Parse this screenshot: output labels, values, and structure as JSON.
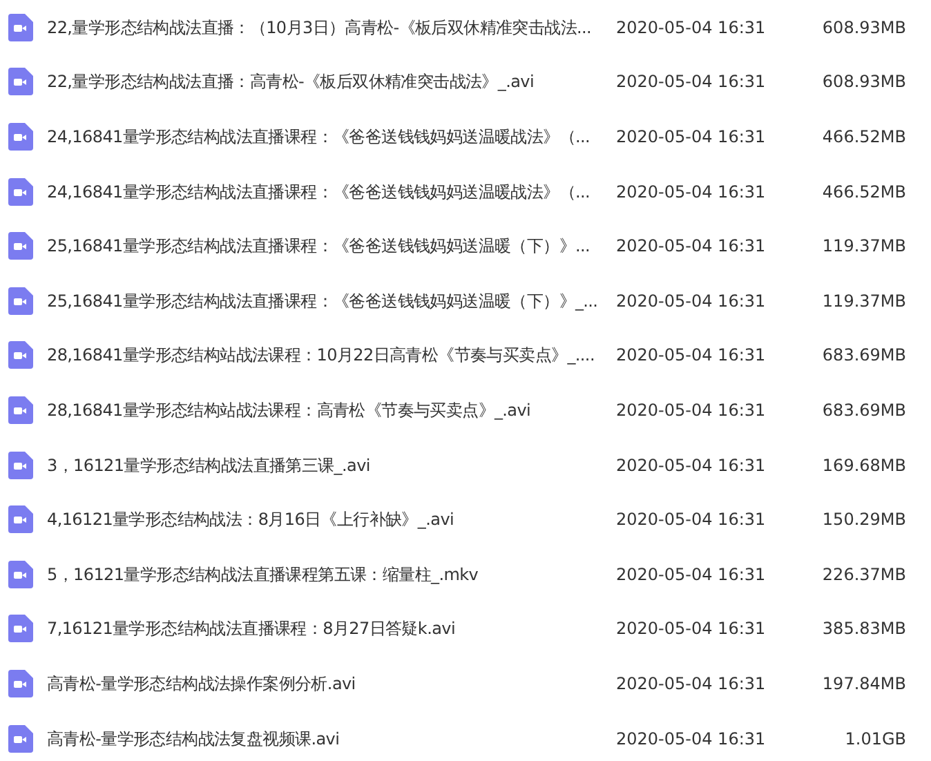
{
  "files": [
    {
      "name": "22,量学形态结构战法直播：（10月3日）高青松-《板后双休精准突击战法...",
      "date": "2020-05-04 16:31",
      "size": "608.93MB"
    },
    {
      "name": "22,量学形态结构战法直播：高青松-《板后双休精准突击战法》_.avi",
      "date": "2020-05-04 16:31",
      "size": "608.93MB"
    },
    {
      "name": "24,16841量学形态结构战法直播课程：《爸爸送钱钱妈妈送温暖战法》（...",
      "date": "2020-05-04 16:31",
      "size": "466.52MB"
    },
    {
      "name": "24,16841量学形态结构战法直播课程：《爸爸送钱钱妈妈送温暖战法》（...",
      "date": "2020-05-04 16:31",
      "size": "466.52MB"
    },
    {
      "name": "25,16841量学形态结构战法直播课程：《爸爸送钱钱妈妈送温暖（下）》...",
      "date": "2020-05-04 16:31",
      "size": "119.37MB"
    },
    {
      "name": "25,16841量学形态结构战法直播课程：《爸爸送钱钱妈妈送温暖（下）》_...",
      "date": "2020-05-04 16:31",
      "size": "119.37MB"
    },
    {
      "name": "28,16841量学形态结构站战法课程：10月22日高青松《节奏与买卖点》_....",
      "date": "2020-05-04 16:31",
      "size": "683.69MB"
    },
    {
      "name": "28,16841量学形态结构站战法课程：高青松《节奏与买卖点》_.avi",
      "date": "2020-05-04 16:31",
      "size": "683.69MB"
    },
    {
      "name": "3，16121量学形态结构战法直播第三课_.avi",
      "date": "2020-05-04 16:31",
      "size": "169.68MB"
    },
    {
      "name": "4,16121量学形态结构战法：8月16日《上行补缺》_.avi",
      "date": "2020-05-04 16:31",
      "size": "150.29MB"
    },
    {
      "name": "5，16121量学形态结构战法直播课程第五课：缩量柱_.mkv",
      "date": "2020-05-04 16:31",
      "size": "226.37MB"
    },
    {
      "name": "7,16121量学形态结构战法直播课程：8月27日答疑k.avi",
      "date": "2020-05-04 16:31",
      "size": "385.83MB"
    },
    {
      "name": "高青松-量学形态结构战法操作案例分析.avi",
      "date": "2020-05-04 16:31",
      "size": "197.84MB"
    },
    {
      "name": "高青松-量学形态结构战法复盘视频课.avi",
      "date": "2020-05-04 16:31",
      "size": "1.01GB"
    }
  ]
}
